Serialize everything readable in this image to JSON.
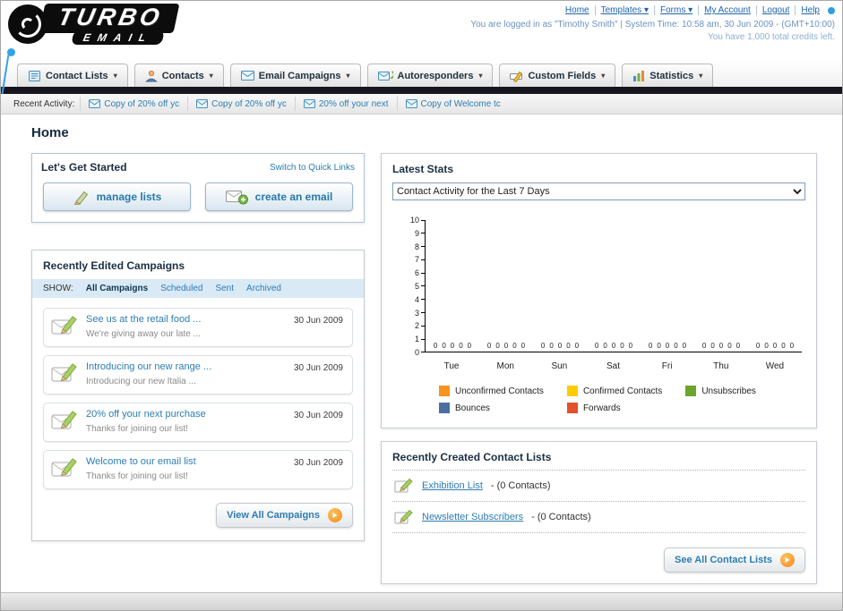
{
  "header": {
    "logo": {
      "line1": "TURBO",
      "line2": "EMAIL"
    },
    "nav_links": [
      "Home",
      "Templates ▾",
      "Forms ▾",
      "My Account",
      "Logout",
      "Help"
    ],
    "login_info": "You are logged in as \"Timothy Smith\" | System Time: 10:58 am, 30 Jun 2009 - (GMT+10:00)",
    "credits_info": "You have 1,000 total credits left."
  },
  "nav": {
    "tabs": [
      {
        "label": "Contact Lists"
      },
      {
        "label": "Contacts"
      },
      {
        "label": "Email Campaigns"
      },
      {
        "label": "Autoresponders"
      },
      {
        "label": "Custom Fields"
      },
      {
        "label": "Statistics"
      }
    ]
  },
  "activity": {
    "label": "Recent Activity:",
    "items": [
      "Copy of 20% off yc",
      "Copy of 20% off yc",
      "20% off your next",
      "Copy of Welcome tc"
    ]
  },
  "page": {
    "title": "Home"
  },
  "get_started": {
    "title": "Let's Get Started",
    "switch_link": "Switch to Quick Links",
    "manage_lists_label": "manage lists",
    "create_email_label": "create an email"
  },
  "campaigns": {
    "title": "Recently Edited Campaigns",
    "show_label": "SHOW:",
    "filters": [
      {
        "label": "All Campaigns"
      },
      {
        "label": "Scheduled"
      },
      {
        "label": "Sent"
      },
      {
        "label": "Archived"
      }
    ],
    "items": [
      {
        "title": "See us at the retail food ...",
        "subtitle": "We're giving away our late ...",
        "date": "30 Jun 2009"
      },
      {
        "title": "Introducing our new range ...",
        "subtitle": "Introducing our new Italia ...",
        "date": "30 Jun 2009"
      },
      {
        "title": "20% off your next purchase",
        "subtitle": "Thanks for joining our list!",
        "date": "30 Jun 2009"
      },
      {
        "title": "Welcome to our email list",
        "subtitle": "Thanks for joining our list!",
        "date": "30 Jun 2009"
      }
    ],
    "view_all_label": "View All Campaigns"
  },
  "stats": {
    "title": "Latest Stats",
    "dropdown_value": "Contact Activity for the Last 7 Days",
    "legend": [
      {
        "label": "Unconfirmed Contacts",
        "color": "#F7941E"
      },
      {
        "label": "Confirmed Contacts",
        "color": "#FFCC00"
      },
      {
        "label": "Unsubscribes",
        "color": "#6CA52E"
      },
      {
        "label": "Bounces",
        "color": "#4A6FA5"
      },
      {
        "label": "Forwards",
        "color": "#E2502C"
      }
    ]
  },
  "chart_data": {
    "type": "bar",
    "title": "Contact Activity for the Last 7 Days",
    "categories": [
      "Tue",
      "Mon",
      "Sun",
      "Sat",
      "Fri",
      "Thu",
      "Wed"
    ],
    "series": [
      {
        "name": "Unconfirmed Contacts",
        "color": "#F7941E",
        "values": [
          0,
          0,
          0,
          0,
          0,
          0,
          0
        ]
      },
      {
        "name": "Confirmed Contacts",
        "color": "#FFCC00",
        "values": [
          0,
          0,
          0,
          0,
          0,
          0,
          0
        ]
      },
      {
        "name": "Unsubscribes",
        "color": "#6CA52E",
        "values": [
          0,
          0,
          0,
          0,
          0,
          0,
          0
        ]
      },
      {
        "name": "Bounces",
        "color": "#4A6FA5",
        "values": [
          0,
          0,
          0,
          0,
          0,
          0,
          0
        ]
      },
      {
        "name": "Forwards",
        "color": "#E2502C",
        "values": [
          0,
          0,
          0,
          0,
          0,
          0,
          0
        ]
      }
    ],
    "ylim": [
      0,
      10
    ],
    "ytick_step": 1,
    "grid": false,
    "legend_position": "bottom",
    "value_labels_shown": true
  },
  "contact_lists": {
    "title": "Recently Created Contact Lists",
    "items": [
      {
        "name": "Exhibition List",
        "suffix": " - (0 Contacts)"
      },
      {
        "name": "Newsletter Subscribers",
        "suffix": " - (0 Contacts)"
      }
    ],
    "see_all_label": "See All Contact Lists"
  }
}
